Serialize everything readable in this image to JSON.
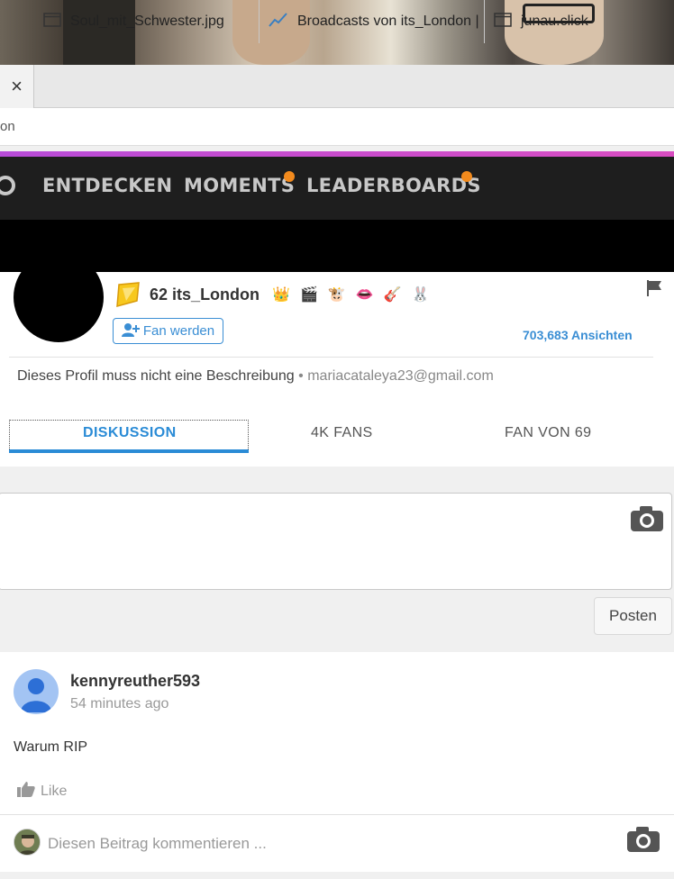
{
  "browser": {
    "tabs": [
      {
        "label": "Soul_mit_Schwester.jpg",
        "icon": "page-icon"
      },
      {
        "label": "Broadcasts von its_London |",
        "icon": "trend-icon"
      },
      {
        "label": "junau.click",
        "icon": "page-icon"
      }
    ],
    "close_label": "×",
    "address_text": "on"
  },
  "nav": {
    "items": [
      {
        "label": "ENTDECKEN",
        "dot": false
      },
      {
        "label": "MOMENTS",
        "dot": true
      },
      {
        "label": "LEADERBOARDS",
        "dot": true
      }
    ],
    "dot_color": "#f28a1d"
  },
  "profile": {
    "level": "62",
    "username": "its_London",
    "badges": [
      "👑",
      "🎬",
      "🐮",
      "👄",
      "🎸",
      "🐰"
    ],
    "fan_button": "Fan werden",
    "views": "703,683 Ansichten",
    "description": "Dieses Profil muss nicht eine Beschreibung",
    "separator": "•",
    "email": "mariacataleya23@gmail.com"
  },
  "profile_tabs": [
    {
      "label": "DISKUSSION",
      "active": true
    },
    {
      "label": "4K FANS",
      "active": false
    },
    {
      "label": "FAN VON 69",
      "active": false
    }
  ],
  "composer": {
    "post_button": "Posten"
  },
  "post": {
    "author": "kennyreuther593",
    "time": "54 minutes ago",
    "text": "Warum RIP",
    "like_label": "Like",
    "comment_placeholder": "Diesen Beitrag kommentieren ..."
  },
  "colors": {
    "accent": "#2a8bd6",
    "nav_bg": "#1e1e1e",
    "accent_line": "#c44dcf"
  }
}
